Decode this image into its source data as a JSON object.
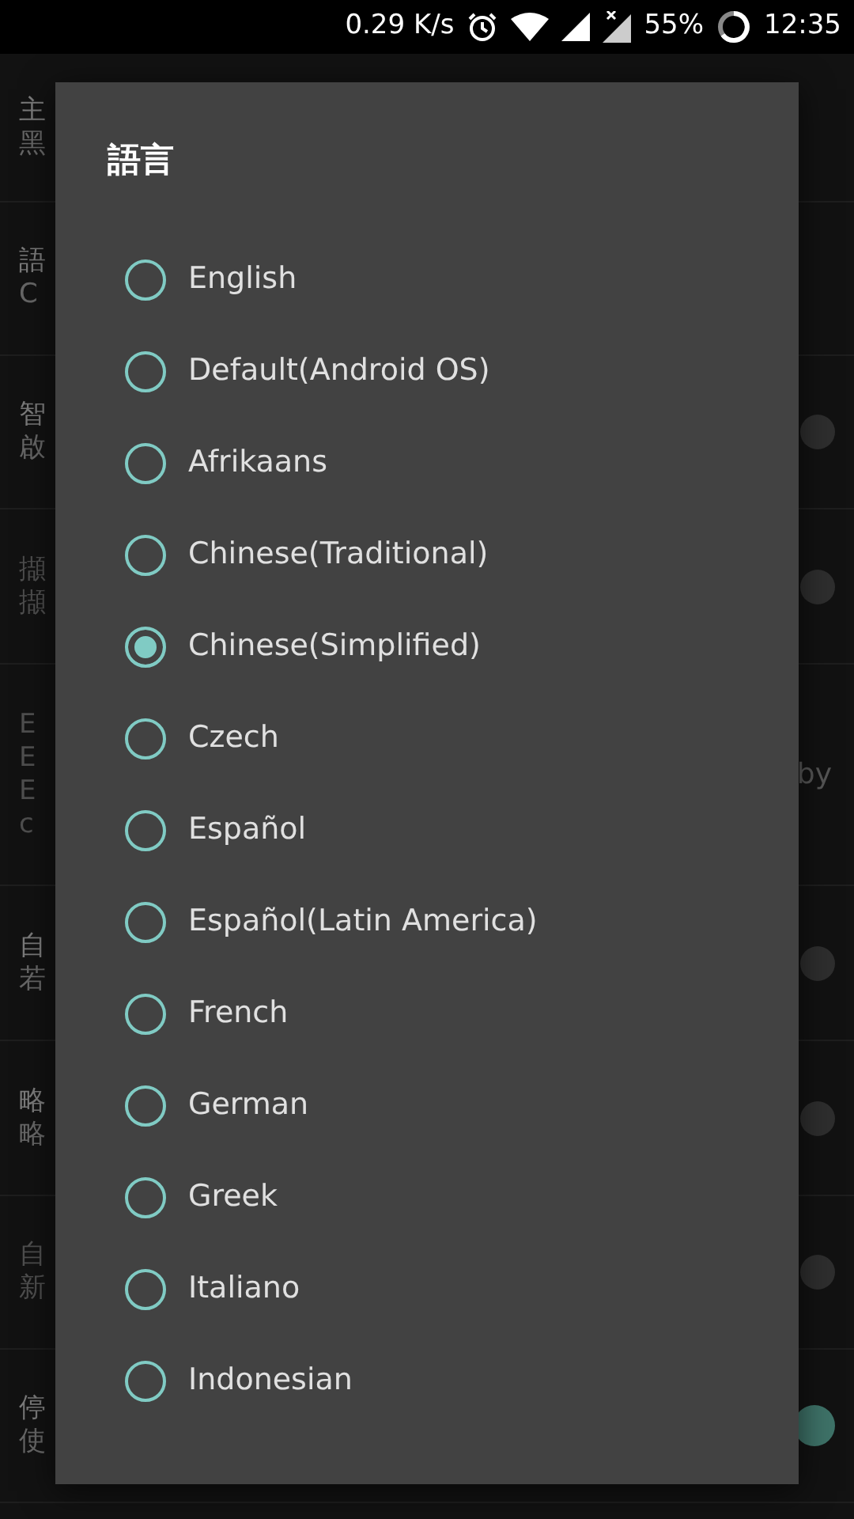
{
  "status_bar": {
    "speed": "0.29 K/s",
    "battery": "55%",
    "time": "12:35"
  },
  "background_rows": [
    {
      "title": "主",
      "subtitle": [
        "黑"
      ],
      "disabled": false
    },
    {
      "title": "語",
      "subtitle": [
        "C"
      ],
      "disabled": false
    },
    {
      "title": "智",
      "subtitle": [
        "啟"
      ],
      "disabled": false,
      "toggle": {
        "on": false
      }
    },
    {
      "title": "擷",
      "subtitle": [
        "擷"
      ],
      "disabled": true,
      "toggle": {
        "on": false
      }
    },
    {
      "title": "E",
      "subtitle": [
        "E",
        "E",
        "c"
      ],
      "disabled": true,
      "right_text": "by"
    },
    {
      "title": "自",
      "subtitle": [
        "若"
      ],
      "disabled": false,
      "toggle": {
        "on": false
      }
    },
    {
      "title": "略",
      "subtitle": [
        "略"
      ],
      "disabled": false,
      "toggle": {
        "on": false
      }
    },
    {
      "title": "自",
      "subtitle": [
        "新"
      ],
      "disabled": true,
      "toggle": {
        "on": false
      }
    },
    {
      "title": "停",
      "subtitle": [
        "使"
      ],
      "disabled": false,
      "toggle": {
        "on": true
      }
    }
  ],
  "dialog": {
    "title": "語言",
    "options": [
      {
        "label": "English",
        "selected": false
      },
      {
        "label": "Default(Android OS)",
        "selected": false
      },
      {
        "label": "Afrikaans",
        "selected": false
      },
      {
        "label": "Chinese(Traditional)",
        "selected": false
      },
      {
        "label": "Chinese(Simplified)",
        "selected": true
      },
      {
        "label": "Czech",
        "selected": false
      },
      {
        "label": "Español",
        "selected": false
      },
      {
        "label": "Español(Latin America)",
        "selected": false
      },
      {
        "label": "French",
        "selected": false
      },
      {
        "label": "German",
        "selected": false
      },
      {
        "label": "Greek",
        "selected": false
      },
      {
        "label": "Italiano",
        "selected": false
      },
      {
        "label": "Indonesian",
        "selected": false
      }
    ]
  }
}
